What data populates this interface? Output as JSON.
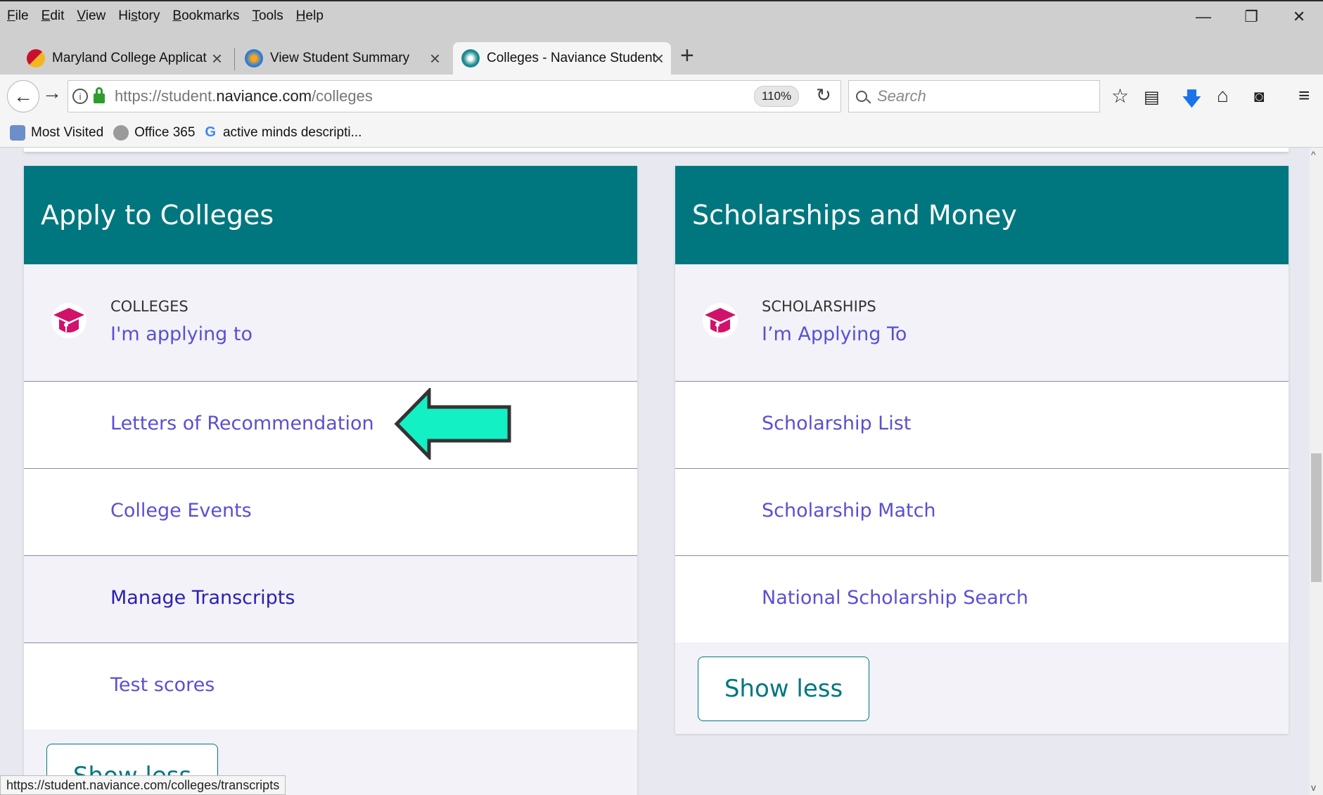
{
  "menu": [
    "File",
    "Edit",
    "View",
    "History",
    "Bookmarks",
    "Tools",
    "Help"
  ],
  "menu_underline": [
    "F",
    "E",
    "V",
    "s",
    "B",
    "T",
    "H"
  ],
  "tabs": [
    {
      "label": "Maryland College Applicatio"
    },
    {
      "label": "View Student Summary"
    },
    {
      "label": "Colleges - Naviance Student"
    }
  ],
  "url": {
    "prefix": "https://student.",
    "domain": "naviance.com",
    "path": "/colleges"
  },
  "zoom": "110%",
  "search_placeholder": "Search",
  "bookmarks": [
    "Most Visited",
    "Office 365",
    "active minds descripti..."
  ],
  "left_card": {
    "title": "Apply to Colleges",
    "category": "COLLEGES",
    "first_link": "I'm applying to",
    "links": [
      "Letters of Recommendation",
      "College Events",
      "Manage Transcripts",
      "Test scores"
    ],
    "button": "Show less"
  },
  "right_card": {
    "title": "Scholarships and Money",
    "category": "SCHOLARSHIPS",
    "first_link": "I’m Applying To",
    "links": [
      "Scholarship List",
      "Scholarship Match",
      "National Scholarship Search"
    ],
    "button": "Show less"
  },
  "status_url": "https://student.naviance.com/colleges/transcripts",
  "colors": {
    "teal": "#00777f",
    "link": "#5a4fd3",
    "accent": "#d1126b",
    "arrow": "#13f0c4"
  }
}
